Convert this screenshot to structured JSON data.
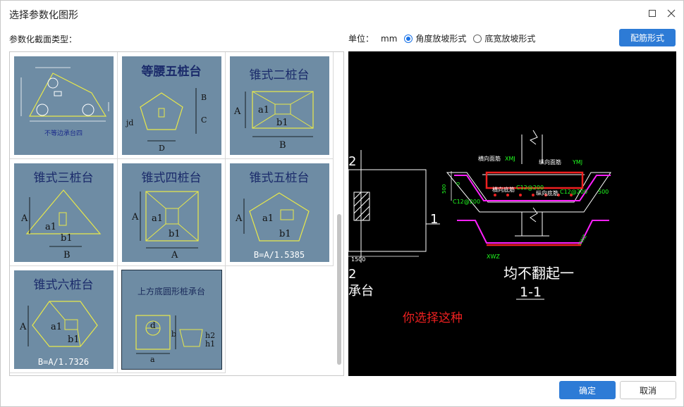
{
  "window": {
    "title": "选择参数化图形",
    "min_icon": "maximize-icon",
    "close_icon": "close-icon"
  },
  "labels": {
    "section_type": "参数化截面类型：",
    "unit_label": "单位：",
    "unit_value": "mm"
  },
  "options": [
    {
      "label": "角度放坡形式",
      "selected": true
    },
    {
      "label": "底宽放坡形式",
      "selected": false
    }
  ],
  "buttons": {
    "rebar_form": "配筋形式",
    "ok": "确定",
    "cancel": "取消"
  },
  "thumbnails": [
    {
      "title": "不等边承台四",
      "dims": [
        "a1",
        "b1"
      ]
    },
    {
      "title": "等腰五桩台",
      "dims": [
        "B",
        "C",
        "jd",
        "D"
      ]
    },
    {
      "title": "锥式二桩台",
      "dims": [
        "A",
        "a1",
        "b1",
        "B"
      ]
    },
    {
      "title": "锥式三桩台",
      "dims": [
        "A",
        "a1",
        "b1",
        "B"
      ]
    },
    {
      "title": "锥式四桩台",
      "dims": [
        "A",
        "a1",
        "b1",
        "A"
      ]
    },
    {
      "title": "锥式五桩台",
      "dims": [
        "A",
        "a1",
        "b1"
      ],
      "formula": "B=A/1.5385"
    },
    {
      "title": "锥式六桩台",
      "dims": [
        "A",
        "a1",
        "b1"
      ],
      "formula": "B=A/1.7326"
    },
    {
      "title": "上方底圆形桩承台",
      "dims": [
        "d",
        "b",
        "a",
        "h2",
        "h1"
      ]
    }
  ],
  "preview": {
    "left_labels": {
      "a": "2",
      "b": "1",
      "c": "2",
      "d": "承台",
      "e": "1500"
    },
    "rebar_labels": [
      "横向面筋",
      "XMJ",
      "纵向面筋",
      "YMJ",
      "横向底筋",
      "C12@200",
      "纵向底筋",
      "C12@200",
      "C12@200",
      "XWZ",
      "500",
      "0",
      "YWZ",
      "500"
    ],
    "caption": "均不翻起一",
    "section": "1-1",
    "note": "你选择这种"
  },
  "colors": {
    "accent": "#2d7bd6",
    "thumb_bg": "#6e8ca4",
    "cad_red": "#ee2020",
    "cad_magenta": "#ff20ff",
    "cad_green": "#20ff20"
  }
}
